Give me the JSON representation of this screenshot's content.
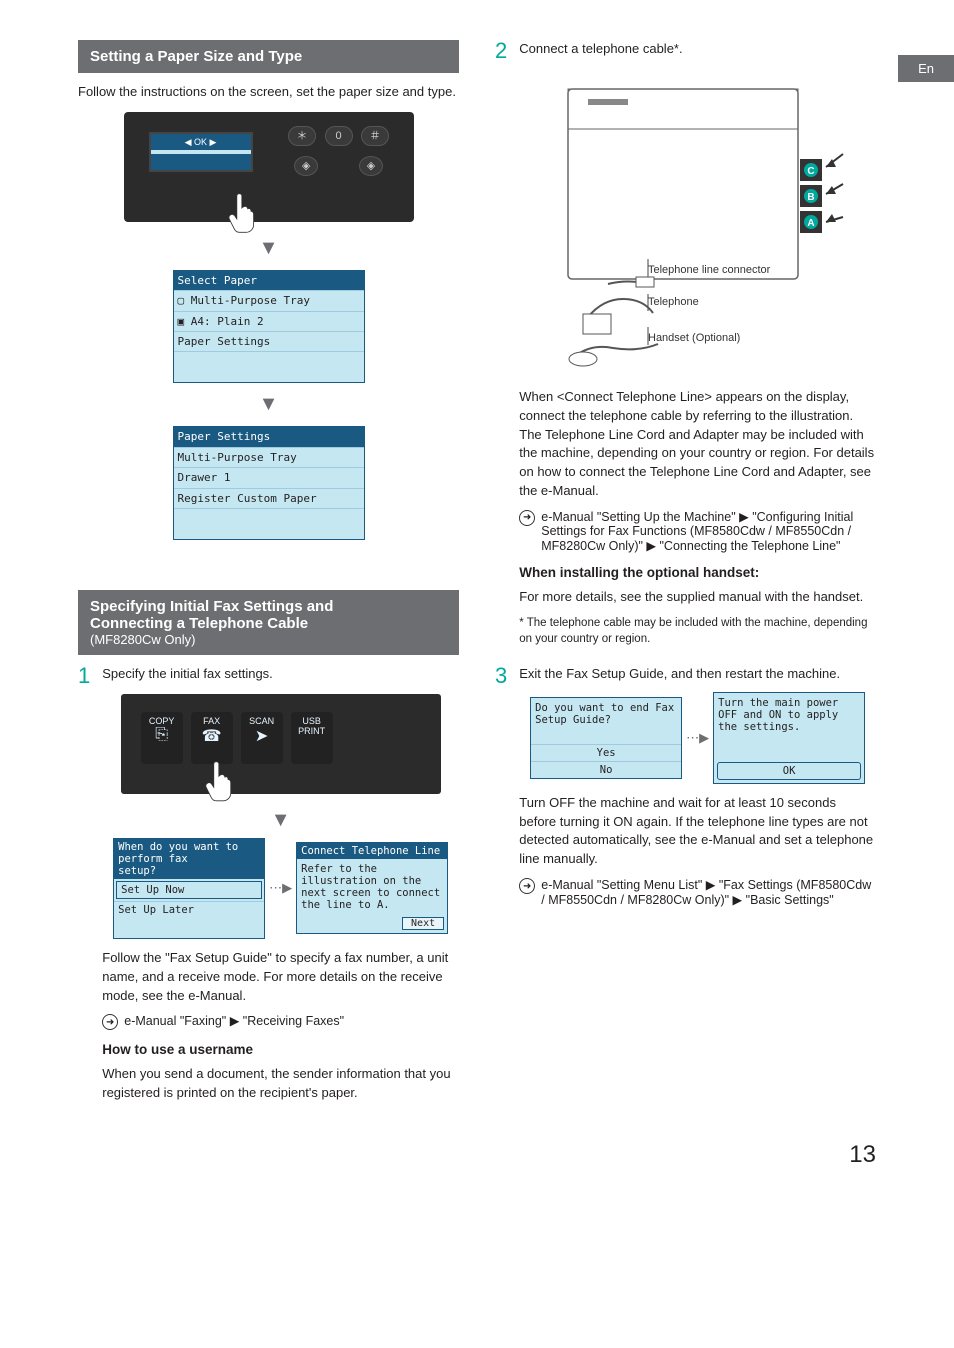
{
  "lang_tab": "En",
  "left": {
    "header1": "Setting a Paper Size and Type",
    "intro1": "Follow the instructions on the screen, set the paper size and type.",
    "panel_keys": {
      "star": "＊",
      "zero": "0",
      "hash": "＃"
    },
    "panel_nav": "◀  OK  ▶",
    "lcd1": {
      "title": "Select Paper",
      "r1": "▢ Multi-Purpose Tray",
      "r2": "▣ A4: Plain 2",
      "r3": "Paper Settings"
    },
    "lcd2": {
      "title": "Paper Settings",
      "r1": "Multi-Purpose Tray",
      "r2": "Drawer 1",
      "r3": "Register Custom Paper"
    },
    "header2_l1": "Specifying Initial Fax Settings and",
    "header2_l2": "Connecting a Telephone Cable",
    "header2_sub": "(MF8280Cw Only)",
    "step1": "Specify the initial fax settings.",
    "modes": {
      "copy": "COPY",
      "fax": "FAX",
      "scan": "SCAN",
      "usb": "USB\nPRINT"
    },
    "fax_lcd_a": {
      "title_l1": "When do you want to perform fax",
      "title_l2": "setup?",
      "opt1": "Set Up Now",
      "opt2": "Set Up Later"
    },
    "fax_lcd_b": {
      "title": "Connect Telephone Line",
      "body": "Refer to the illustration on the next screen to connect the line to A.",
      "next": "Next"
    },
    "step1_note": "Follow the \"Fax Setup Guide\" to specify a fax number, a unit name, and a receive mode. For more details on the receive mode, see the e-Manual.",
    "eref1": "e-Manual \"Faxing\" ▶ \"Receiving Faxes\"",
    "h_user": "How to use a username",
    "user_p": "When you send a document, the sender information that you registered is printed on the recipient's paper."
  },
  "right": {
    "step2": "Connect a telephone cable*.",
    "labels": {
      "tlc": "Telephone line connector",
      "tel": "Telephone",
      "hand": "Handset (Optional)"
    },
    "ports": {
      "c": "C",
      "b": "B",
      "a": "A"
    },
    "step2_p": "When <Connect Telephone Line> appears on the display, connect the telephone cable by referring to the illustration. The Telephone Line Cord and Adapter may be included with the machine, depending on your country or region. For details on how to connect the Telephone Line Cord and Adapter, see the e-Manual.",
    "eref2": "e-Manual \"Setting Up the Machine\" ▶ \"Configuring Initial Settings for Fax Functions (MF8580Cdw / MF8550Cdn / MF8280Cw Only)\" ▶ \"Connecting the Telephone Line\"",
    "h_handset": "When installing the optional handset:",
    "handset_p": "For more details, see the supplied manual with the handset.",
    "footnote": "* The telephone cable may be included with the machine, depending on your country or region.",
    "step3": "Exit the Fax Setup Guide, and then restart the machine.",
    "lcd3a": {
      "body": "Do you want to end Fax Setup Guide?",
      "yes": "Yes",
      "no": "No"
    },
    "lcd3b": {
      "body": "Turn the main power OFF and ON to apply the settings.",
      "ok": "OK"
    },
    "step3_p": "Turn OFF the machine and wait for at least 10 seconds before turning it ON again. If the telephone line types are not detected automatically, see the e-Manual and set a telephone line manually.",
    "eref3": "e-Manual \"Setting Menu List\" ▶ \"Fax Settings (MF8580Cdw / MF8550Cdn / MF8280Cw Only)\" ▶ \"Basic Settings\""
  },
  "page_number": "13"
}
